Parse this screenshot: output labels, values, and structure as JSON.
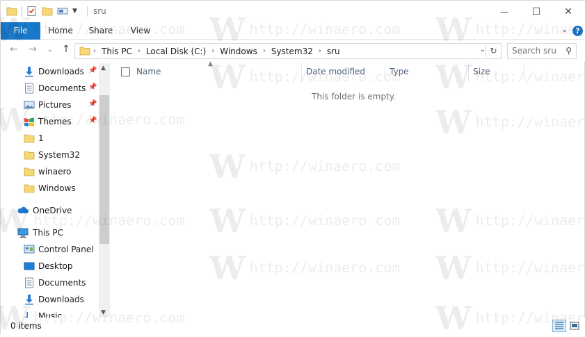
{
  "window": {
    "title": "sru",
    "controls": {
      "minimize": "—",
      "maximize": "☐",
      "close": "✕"
    }
  },
  "ribbon": {
    "tabs": [
      "File",
      "Home",
      "Share",
      "View"
    ],
    "help": "?"
  },
  "address": {
    "crumbs": [
      "This PC",
      "Local Disk (C:)",
      "Windows",
      "System32",
      "sru"
    ]
  },
  "search": {
    "placeholder": "Search sru"
  },
  "nav": {
    "quick_access": [
      {
        "label": "Downloads",
        "icon": "downloads-icon",
        "pinned": true
      },
      {
        "label": "Documents",
        "icon": "documents-icon",
        "pinned": true
      },
      {
        "label": "Pictures",
        "icon": "pictures-icon",
        "pinned": true
      },
      {
        "label": "Themes",
        "icon": "themes-icon",
        "pinned": true
      },
      {
        "label": "1",
        "icon": "folder-icon",
        "pinned": false
      },
      {
        "label": "System32",
        "icon": "folder-icon",
        "pinned": false
      },
      {
        "label": "winaero",
        "icon": "folder-icon",
        "pinned": false
      },
      {
        "label": "Windows",
        "icon": "folder-icon",
        "pinned": false
      }
    ],
    "onedrive": "OneDrive",
    "this_pc": "This PC",
    "this_pc_items": [
      {
        "label": "Control Panel",
        "icon": "control-panel-icon"
      },
      {
        "label": "Desktop",
        "icon": "desktop-icon"
      },
      {
        "label": "Documents",
        "icon": "documents-icon"
      },
      {
        "label": "Downloads",
        "icon": "downloads-icon"
      },
      {
        "label": "Music",
        "icon": "music-icon"
      }
    ]
  },
  "columns": [
    "Name",
    "Date modified",
    "Type",
    "Size"
  ],
  "empty_message": "This folder is empty.",
  "status": {
    "item_count": "0 items"
  },
  "watermark": {
    "text": "http://winaero.com",
    "mark": "W"
  },
  "colors": {
    "accent": "#1979ca",
    "folder": "#f8d775",
    "header_text": "#4c607a"
  }
}
